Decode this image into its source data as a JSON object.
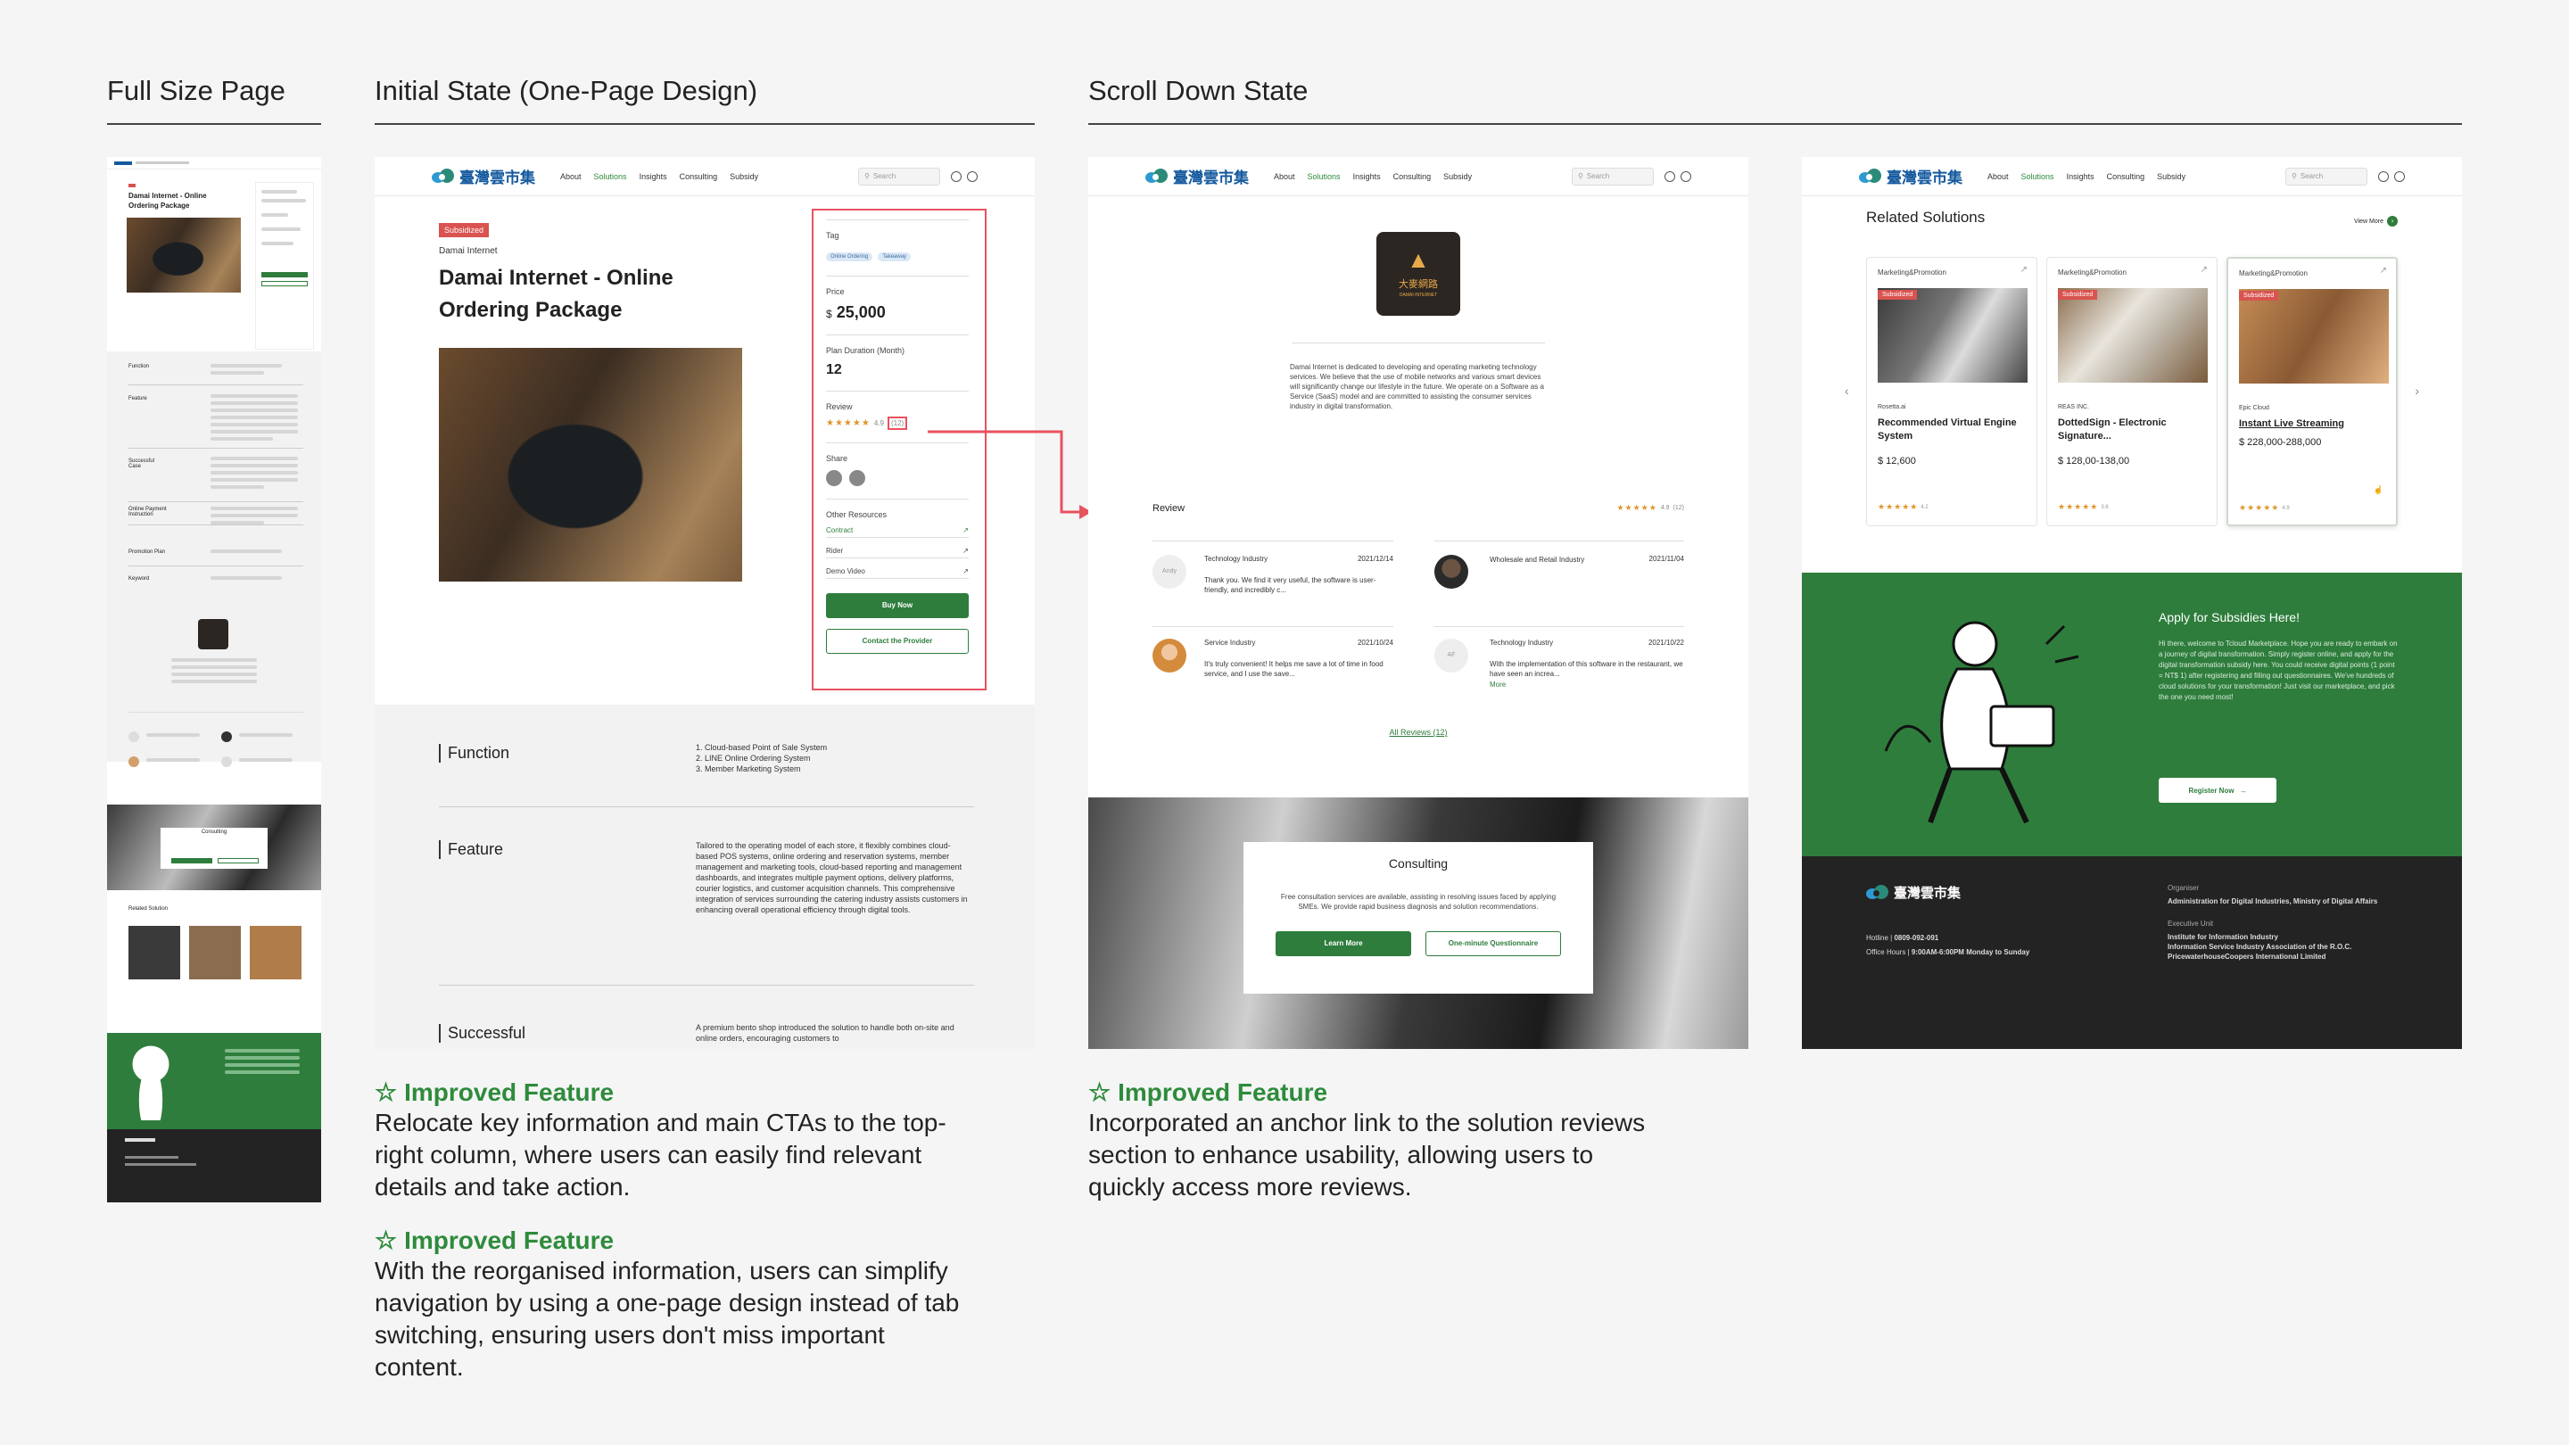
{
  "headings": {
    "full": "Full Size Page",
    "initial": "Initial State (One-Page Design)",
    "scroll": "Scroll Down State"
  },
  "nav": {
    "brand": "臺灣雲市集",
    "links": [
      "About",
      "Solutions",
      "Insights",
      "Consulting",
      "Subsidy"
    ],
    "search_placeholder": "Search"
  },
  "product": {
    "badge": "Subsidized",
    "vendor": "Damai Internet",
    "title_line1": "Damai Internet - Online",
    "title_line2": "Ordering Package",
    "tag_label": "Tag",
    "tags": [
      "Online Ordering",
      "Takeaway"
    ],
    "price_label": "Price",
    "price_currency": "$",
    "price_value": "25,000",
    "duration_label": "Plan Duration (Month)",
    "duration_value": "12",
    "review_label": "Review",
    "review_score": "4.9",
    "review_count": "(12)",
    "share_label": "Share",
    "resources_label": "Other Resources",
    "resources": [
      "Contract",
      "Rider",
      "Demo Video"
    ],
    "buy_now": "Buy Now",
    "contact": "Contact the Provider"
  },
  "details": {
    "function_label": "Function",
    "function_items": [
      "1. Cloud-based Point of Sale System",
      "2. LINE Online Ordering System",
      "3. Member Marketing System"
    ],
    "feature_label": "Feature",
    "feature_text": "Tailored to the operating model of each store, it flexibly combines cloud-based POS systems, online ordering and reservation systems, member management and marketing tools, cloud-based reporting and management dashboards, and integrates multiple payment options, delivery platforms, courier logistics, and customer acquisition channels. This comprehensive integration of services surrounding the catering industry assists customers in enhancing overall operational efficiency through digital tools.",
    "successful_label": "Successful",
    "successful_text": "A premium bento shop introduced the solution to handle both on-site and online orders, encouraging customers to"
  },
  "scroll": {
    "vendor_logo_text": "大麥網路",
    "vendor_logo_sub": "DAMAI INTERNET",
    "about": "Damai Internet is dedicated to developing and operating marketing technology services. We believe that the use of mobile networks and various smart devices will significantly change our lifestyle in the future. We operate on a Software as a Service (SaaS) model and are committed to assisting the consumer services industry in digital transformation.",
    "review_heading": "Review",
    "review_score": "4.9",
    "review_count": "(12)",
    "reviews": [
      {
        "initials": "Andy",
        "industry": "Technology Industry",
        "date": "2021/12/14",
        "text": "Thank you. We find it very useful, the software is user-friendly, and incredibly c..."
      },
      {
        "initials": "",
        "industry": "Wholesale and Retail Industry",
        "date": "2021/11/04",
        "text": ""
      },
      {
        "initials": "",
        "industry": "Service Industry",
        "date": "2021/10/24",
        "text": "It's truly convenient! It helps me save a lot of time in food service, and I use the save..."
      },
      {
        "initials": "AF",
        "industry": "Technology Industry",
        "date": "2021/10/22",
        "text": "With the implementation of this software in the restaurant, we have seen an increa..."
      }
    ],
    "more": "More",
    "all_reviews": "All Reviews (12)",
    "consult_title": "Consulting",
    "consult_text": "Free consultation services are available, assisting in resolving issues faced by applying SMEs. We provide rapid business diagnosis and solution recommendations.",
    "learn_more": "Learn More",
    "questionnaire": "One-minute Questionnaire"
  },
  "related": {
    "heading": "Related Solutions",
    "view_more": "View More",
    "cards": [
      {
        "category": "Marketing&Promotion",
        "badge": "Subsidized",
        "vendor": "Rosetta.ai",
        "title": "Recommended Virtual Engine System",
        "price": "$ 12,600",
        "score": "4.2"
      },
      {
        "category": "Marketing&Promotion",
        "badge": "Subsidized",
        "vendor": "REAS INC.",
        "title": "DottedSign - Electronic Signature...",
        "price": "$ 128,00-138,00",
        "score": "3.6"
      },
      {
        "category": "Marketing&Promotion",
        "badge": "Subsidized",
        "vendor": "Epic Cloud",
        "title": "Instant Live Streaming",
        "price": "$ 228,000-288,000",
        "score": "4.9"
      }
    ],
    "subsidy_title": "Apply for Subsidies Here!",
    "subsidy_text": "Hi there, welcome to Tcloud Marketplace. Hope you are ready to embark on a journey of digital transformation. Simply register online, and apply for the digital transformation subsidy here. You could receive digital points (1 point = NT$ 1) after registering and filling out questionnaires. We've hundreds of cloud solutions for your transformation! Just visit our marketplace, and pick the one you need most!",
    "register": "Register Now",
    "footer_brand": "臺灣雲市集",
    "hotline_label": "Hotline",
    "hotline": "0809-092-091",
    "hours_label": "Office Hours",
    "hours": "9:00AM-6:00PM Monday to Sunday",
    "organiser_label": "Organiser",
    "organiser": "Administration for Digital Industries, Ministry of Digital Affairs",
    "executive_label": "Executive Unit",
    "executive": [
      "Institute for Information Industry",
      "Information Service Industry Association of the R.O.C.",
      "PricewaterhouseCoopers International Limited"
    ]
  },
  "notes": [
    {
      "title": "Improved Feature",
      "lines": [
        "Relocate key information and main CTAs to the top-",
        "right column, where users can easily find relevant",
        "details and take action."
      ]
    },
    {
      "title": "Improved Feature",
      "lines": [
        "With the reorganised information, users can simplify",
        "navigation by using a one-page design instead of tab",
        "switching, ensuring users don't miss important",
        "content."
      ]
    },
    {
      "title": "Improved Feature",
      "lines": [
        "Incorporated an anchor link to the solution reviews",
        "section to enhance usability, allowing users to",
        "quickly access more reviews."
      ]
    }
  ],
  "mini": {
    "title": "Damai Internet - Online Ordering Package",
    "labels": [
      "Function",
      "Feature",
      "Successful Case",
      "Online Payment Instruction",
      "Promotion Plan",
      "Keyword"
    ],
    "consulting": "Consulting",
    "related": "Related Solution"
  },
  "colors": {
    "green": "#2e7d3c",
    "accent_red": "#e8525f",
    "dark": "#222222",
    "badge": "#d9534f"
  }
}
